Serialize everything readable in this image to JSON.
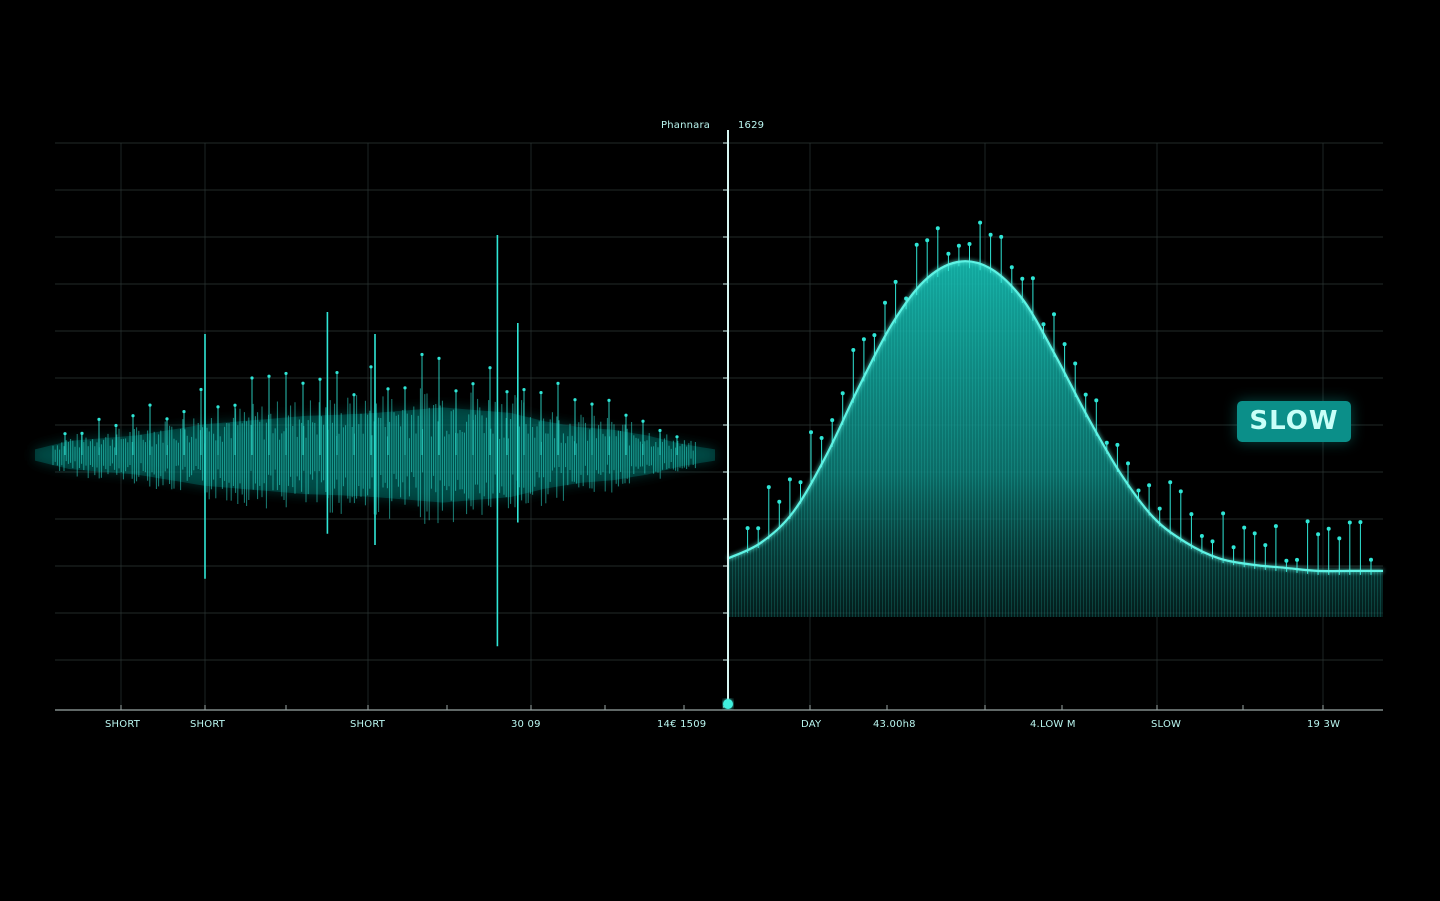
{
  "colors": {
    "background": "#000000",
    "accent": "#2fe6d6",
    "fill": "#0e8f88",
    "grid": "#2a3433",
    "text": "#b9f5ef"
  },
  "header": {
    "left_label": "Phannara",
    "right_label": "1629"
  },
  "badge": {
    "text": "SLOW"
  },
  "x_labels": [
    "SHORT",
    "SHORT",
    "SHORT",
    "30 09",
    "14€ 1509",
    "DAY",
    "43.00h8",
    "4.LOW M",
    "SLOW",
    "19 3W"
  ],
  "chart_data": [
    {
      "type": "line",
      "description_kind": "waveform",
      "x": [
        0,
        0.05,
        0.1,
        0.15,
        0.2,
        0.25,
        0.3,
        0.35,
        0.4,
        0.45,
        0.5,
        0.55,
        0.6,
        0.65,
        0.7,
        0.75,
        0.8,
        0.85,
        0.9,
        0.95,
        1.0
      ],
      "envelope": [
        0.1,
        0.25,
        0.3,
        0.35,
        0.45,
        0.55,
        0.6,
        0.65,
        0.7,
        0.72,
        0.75,
        0.8,
        0.85,
        0.8,
        0.75,
        0.6,
        0.5,
        0.45,
        0.35,
        0.2,
        0.1
      ],
      "spikes": [
        {
          "x": 0.25,
          "up": 0.55,
          "down": 0.55
        },
        {
          "x": 0.43,
          "up": 0.65,
          "down": 0.35
        },
        {
          "x": 0.5,
          "up": 0.55,
          "down": 0.4
        },
        {
          "x": 0.68,
          "up": 1.0,
          "down": 0.85
        },
        {
          "x": 0.71,
          "up": 0.6,
          "down": 0.3
        }
      ],
      "x_tick_labels": [
        "SHORT",
        "SHORT",
        "SHORT",
        "30 09",
        "14€ 1509"
      ],
      "grid": true
    },
    {
      "type": "area",
      "description_kind": "bell curve with data points",
      "x": [
        0,
        0.05,
        0.1,
        0.15,
        0.2,
        0.25,
        0.3,
        0.35,
        0.4,
        0.45,
        0.5,
        0.55,
        0.6,
        0.65,
        0.7,
        0.75,
        0.8,
        0.85,
        0.9,
        0.95,
        1.0
      ],
      "y": [
        0.05,
        0.1,
        0.2,
        0.38,
        0.6,
        0.8,
        0.94,
        1.0,
        0.98,
        0.88,
        0.7,
        0.5,
        0.32,
        0.18,
        0.1,
        0.05,
        0.03,
        0.02,
        0.01,
        0.01,
        0.01
      ],
      "x_tick_labels": [
        "DAY",
        "43.00h8",
        "4.LOW M",
        "SLOW",
        "19 3W"
      ],
      "annotation": "SLOW",
      "grid": true
    }
  ]
}
